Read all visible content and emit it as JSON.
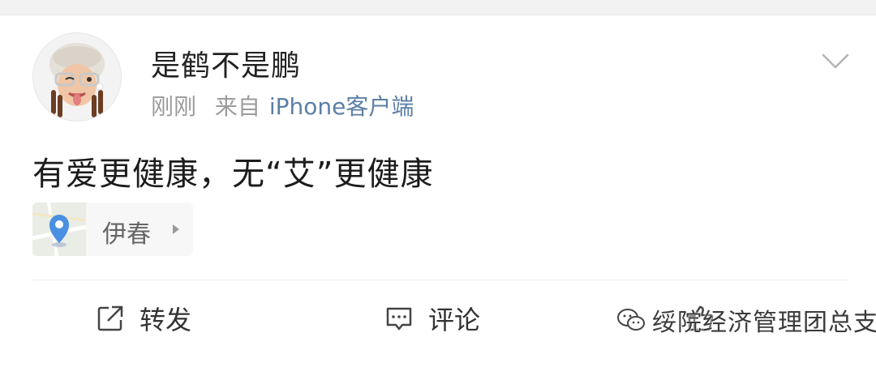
{
  "post": {
    "username": "是鹤不是鹏",
    "time": "刚刚",
    "source_prefix": "来自",
    "source_client": "iPhone客户端",
    "content": "有爱更健康，无“艾”更健康",
    "location": "伊春"
  },
  "actions": {
    "forward": "转发",
    "comment": "评论",
    "like": ""
  },
  "watermark": "绥院经济管理团总支",
  "icons": {
    "avatar": "memoji-avatar",
    "menu": "chevron-down-icon",
    "location": "location-pin-icon",
    "forward": "share-icon",
    "comment": "comment-icon",
    "like": "thumbs-up-icon",
    "watermark": "wechat-icon"
  },
  "colors": {
    "link": "#5b7fa6",
    "pin": "#4a90e2",
    "muted": "#9b9b9b"
  }
}
